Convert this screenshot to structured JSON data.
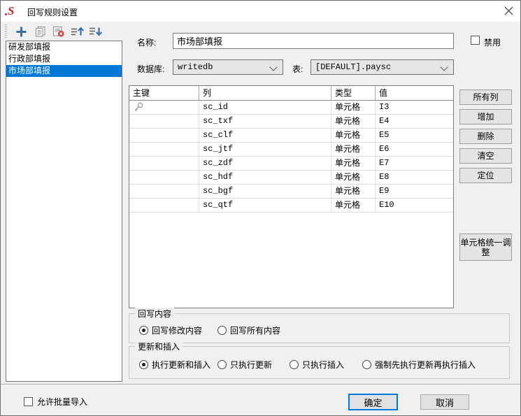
{
  "window": {
    "title": "回写规则设置",
    "logo_letter": "S"
  },
  "toolbar": {
    "icons": [
      "add-icon",
      "copy-icon",
      "delete-icon",
      "move-up-icon",
      "move-down-icon"
    ]
  },
  "rule_list": {
    "items": [
      {
        "label": "研发部填报",
        "selected": false
      },
      {
        "label": "行政部填报",
        "selected": false
      },
      {
        "label": "市场部填报",
        "selected": true
      }
    ]
  },
  "form": {
    "name_label": "名称:",
    "name_value": "市场部填报",
    "disable_label": "禁用",
    "database_label": "数据库:",
    "database_value": "writedb",
    "table_label": "表:",
    "table_value": "[DEFAULT].paysc"
  },
  "mapping_table": {
    "headers": [
      "主键",
      "列",
      "类型",
      "值"
    ],
    "rows": [
      {
        "primary_key": true,
        "column": "sc_id",
        "type": "单元格",
        "value": "I3"
      },
      {
        "primary_key": false,
        "column": "sc_txf",
        "type": "单元格",
        "value": "E4"
      },
      {
        "primary_key": false,
        "column": "sc_clf",
        "type": "单元格",
        "value": "E5"
      },
      {
        "primary_key": false,
        "column": "sc_jtf",
        "type": "单元格",
        "value": "E6"
      },
      {
        "primary_key": false,
        "column": "sc_zdf",
        "type": "单元格",
        "value": "E7"
      },
      {
        "primary_key": false,
        "column": "sc_hdf",
        "type": "单元格",
        "value": "E8"
      },
      {
        "primary_key": false,
        "column": "sc_bgf",
        "type": "单元格",
        "value": "E9"
      },
      {
        "primary_key": false,
        "column": "sc_qtf",
        "type": "单元格",
        "value": "E10"
      }
    ]
  },
  "side_buttons": {
    "all_columns": "所有列",
    "add": "增加",
    "delete": "删除",
    "clear": "清空",
    "locate": "定位",
    "cell_adjust": "单元格统一调整"
  },
  "writeback_content": {
    "title": "回写内容",
    "options": [
      {
        "label": "回写修改内容",
        "selected": true
      },
      {
        "label": "回写所有内容",
        "selected": false
      }
    ]
  },
  "update_insert": {
    "title": "更新和插入",
    "options": [
      {
        "label": "执行更新和插入",
        "selected": true
      },
      {
        "label": "只执行更新",
        "selected": false
      },
      {
        "label": "只执行插入",
        "selected": false
      },
      {
        "label": "强制先执行更新再执行插入",
        "selected": false
      }
    ]
  },
  "footer": {
    "batch_import_label": "允许批量导入",
    "ok_label": "确定",
    "cancel_label": "取消"
  }
}
